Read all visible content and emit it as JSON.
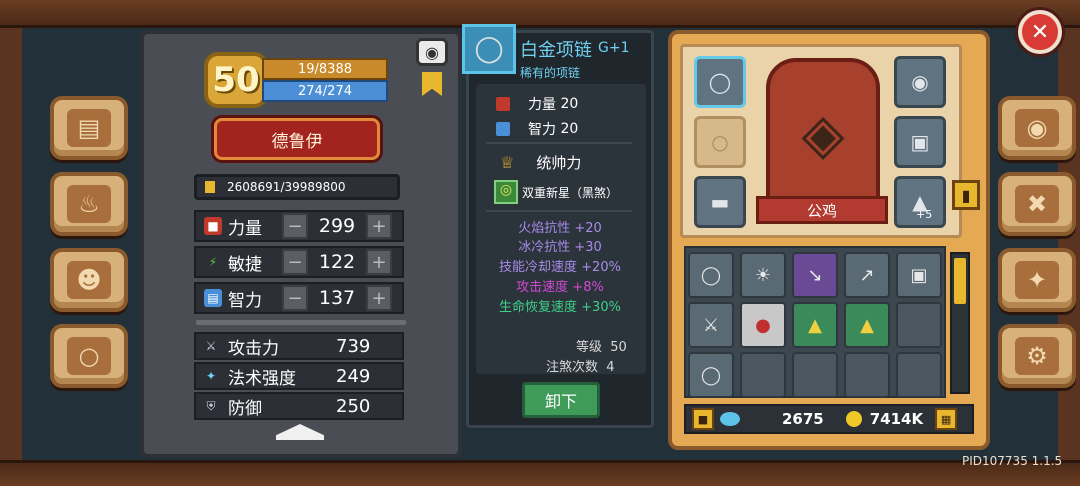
{
  "hero": {
    "level": "50",
    "xp": "19/8388",
    "hp": "274/274",
    "class_name": "德鲁伊",
    "gold": "2608691/39989800"
  },
  "stats": [
    {
      "label": "力量",
      "value": "299",
      "icon": "fist-icon",
      "color": "#c0392b"
    },
    {
      "label": "敏捷",
      "value": "122",
      "icon": "lightning-icon",
      "color": "#5fbf3a"
    },
    {
      "label": "智力",
      "value": "137",
      "icon": "book-icon",
      "color": "#4a90d9"
    }
  ],
  "attributes": [
    {
      "label": "攻击力",
      "value": "739",
      "icon": "sword-icon"
    },
    {
      "label": "法术强度",
      "value": "249",
      "icon": "wand-icon"
    },
    {
      "label": "防御",
      "value": "250",
      "icon": "shield-icon"
    }
  ],
  "item": {
    "name": "白金项链",
    "grade": "G+1",
    "rarity": "稀有的项链",
    "requirements": [
      {
        "label": "力量",
        "value": "20",
        "color": "#c0392b"
      },
      {
        "label": "智力",
        "value": "20",
        "color": "#4a90d9"
      }
    ],
    "skill_title": "统帅力",
    "skill_name": "双重新星（黑煞）",
    "bonuses": [
      {
        "text": "火焰抗性 +20",
        "color": "#a88be8"
      },
      {
        "text": "冰冷抗性 +30",
        "color": "#a88be8"
      },
      {
        "text": "技能冷却速度 +20%",
        "color": "#a88be8"
      },
      {
        "text": "攻击速度 +8%",
        "color": "#d04bd0"
      },
      {
        "text": "生命恢复速度 +30%",
        "color": "#3fd08a"
      }
    ],
    "level_label": "等级",
    "level_value": "50",
    "infuse_label": "注煞次数",
    "infuse_value": "4",
    "unequip_label": "卸下"
  },
  "pet": {
    "name": "公鸡",
    "upgrade": "+5"
  },
  "currency": {
    "gems": "2675",
    "coins": "7414K"
  },
  "build_id": "PID107735 1.1.5"
}
